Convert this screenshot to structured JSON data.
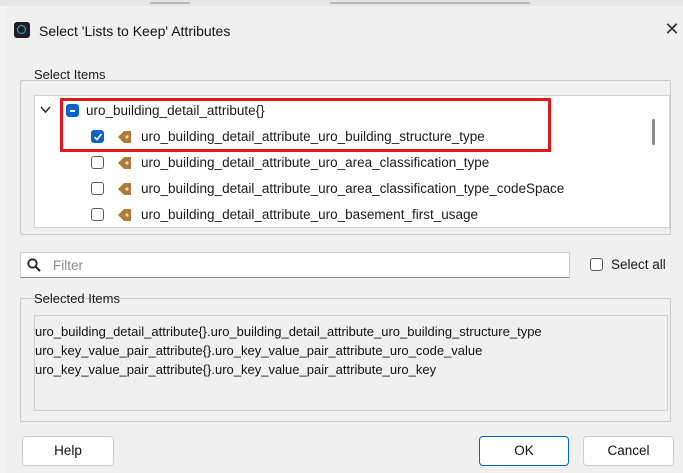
{
  "window": {
    "title": "Select 'Lists to Keep' Attributes",
    "close_glyph": "✕",
    "app_icon": "fme-app-icon"
  },
  "select_items": {
    "group_label": "Select Items",
    "tree": [
      {
        "label": "uro_building_detail_attribute{}",
        "state": "partial",
        "expanded": true
      },
      {
        "label": "uro_building_detail_attribute_uro_building_structure_type",
        "state": "checked"
      },
      {
        "label": "uro_building_detail_attribute_uro_area_classification_type",
        "state": "unchecked"
      },
      {
        "label": "uro_building_detail_attribute_uro_area_classification_type_codeSpace",
        "state": "unchecked"
      },
      {
        "label": "uro_building_detail_attribute_uro_basement_first_usage",
        "state": "unchecked"
      }
    ]
  },
  "filter": {
    "placeholder": "Filter",
    "value": ""
  },
  "select_all": {
    "label": "Select all",
    "checked": false
  },
  "selected_items": {
    "group_label": "Selected Items",
    "lines": [
      "uro_building_detail_attribute{}.uro_building_detail_attribute_uro_building_structure_type",
      "uro_key_value_pair_attribute{}.uro_key_value_pair_attribute_uro_code_value",
      "uro_key_value_pair_attribute{}.uro_key_value_pair_attribute_uro_key"
    ]
  },
  "buttons": {
    "help": "Help",
    "ok": "OK",
    "cancel": "Cancel"
  },
  "colors": {
    "accent": "#0a64c8",
    "highlight": "#e01b1b",
    "attr_icon": "#b07a3a"
  }
}
